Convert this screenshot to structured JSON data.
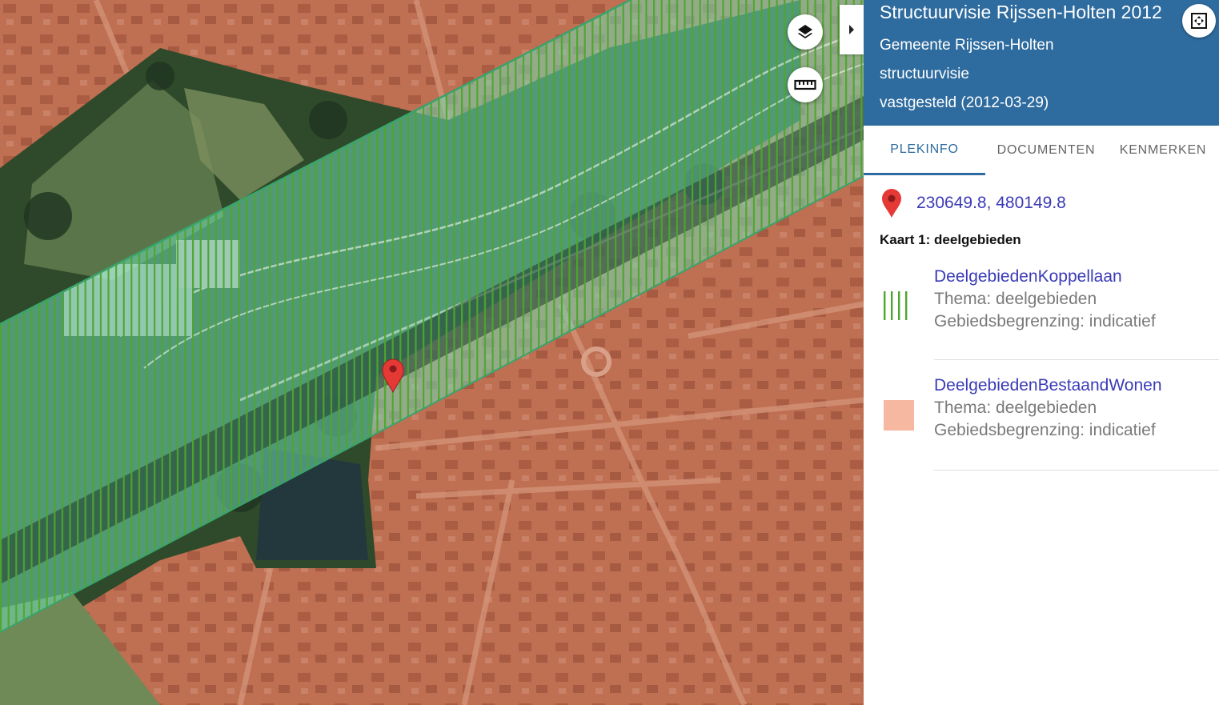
{
  "panel": {
    "title": "Structuurvisie Rijssen-Holten 2012",
    "authority": "Gemeente Rijssen-Holten",
    "plan_type": "structuurvisie",
    "status": "vastgesteld (2012-03-29)",
    "tabs": [
      {
        "label": "PLEKINFO",
        "active": true
      },
      {
        "label": "DOCUMENTEN",
        "active": false
      },
      {
        "label": "KENMERKEN",
        "active": false
      }
    ],
    "location": {
      "coordinates": "230649.8, 480149.8",
      "icon": "map-pin-icon"
    },
    "map_section_title": "Kaart 1: deelgebieden",
    "legend": [
      {
        "name": "DeelgebiedenKoppellaan",
        "thema": "Thema: deelgebieden",
        "begrenzing": "Gebiedsbegrenzing: indicatief",
        "swatch": "green-vertical-hatch"
      },
      {
        "name": "DeelgebiedenBestaandWonen",
        "thema": "Thema: deelgebieden",
        "begrenzing": "Gebiedsbegrenzing: indicatief",
        "swatch": "salmon-fill"
      }
    ]
  },
  "map": {
    "controls": [
      {
        "name": "layers-icon"
      },
      {
        "name": "ruler-icon"
      },
      {
        "name": "chevron-right-icon"
      },
      {
        "name": "fullscreen-icon"
      }
    ],
    "colors": {
      "bestaand_wonen_overlay": "#c8694a",
      "koppellaan_band": "#5fd3a8",
      "koppellaan_hatch": "#4ea62c",
      "header_blue": "#2e6b9e",
      "marker_red": "#e53935"
    }
  }
}
